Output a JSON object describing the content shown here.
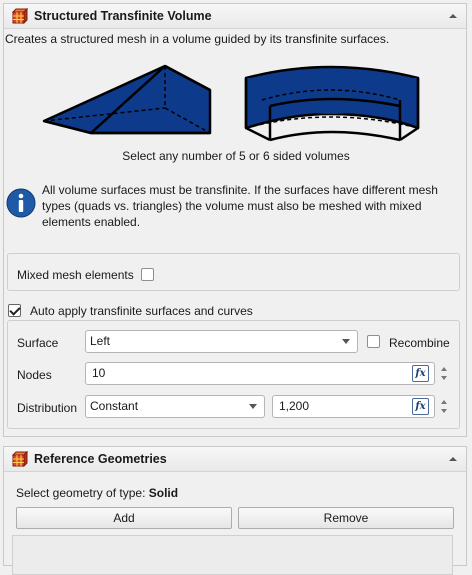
{
  "panel1": {
    "title": "Structured Transfinite Volume",
    "description": "Creates a structured mesh in a volume guided by its transfinite surfaces.",
    "caption": "Select any number of 5 or 6 sided volumes",
    "info": "All volume surfaces must be transfinite. If the surfaces have different mesh types (quads vs. triangles) the volume must also be meshed with mixed elements enabled.",
    "mixed_label": "Mixed mesh elements",
    "mixed_checked": false,
    "auto_apply_label": "Auto apply transfinite surfaces and curves",
    "auto_apply_checked": true,
    "surface_label": "Surface",
    "surface_value": "Left",
    "recombine_label": "Recombine",
    "recombine_checked": false,
    "nodes_label": "Nodes",
    "nodes_value": "10",
    "distribution_label": "Distribution",
    "distribution_value": "Constant",
    "distribution_param": "1,200",
    "fx_label": "fx"
  },
  "panel2": {
    "title": "Reference Geometries",
    "select_prefix": "Select geometry of type: ",
    "select_type": "Solid",
    "add_label": "Add",
    "remove_label": "Remove"
  },
  "colors": {
    "shape_fill": "#0e3a8c",
    "shape_stroke": "#000000",
    "info_blue": "#1f5aa8"
  }
}
